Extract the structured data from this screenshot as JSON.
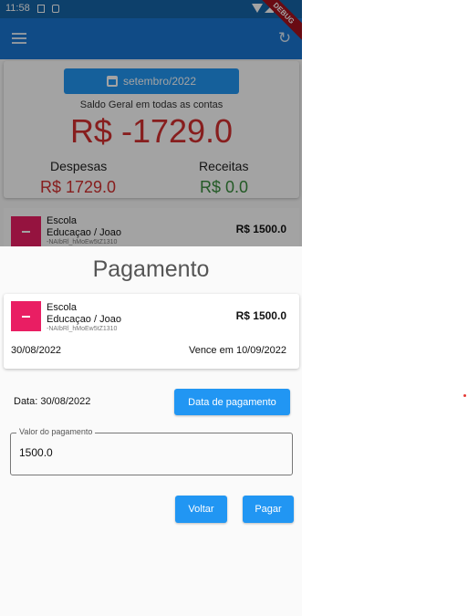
{
  "status_bar": {
    "time": "11:58"
  },
  "app_bar": {
    "debug_banner": "DEBUG"
  },
  "summary": {
    "month_button": "setembro/2022",
    "saldo_label": "Saldo Geral em todas as contas",
    "saldo_value": "R$ -1729.0",
    "despesas_label": "Despesas",
    "despesas_value": "R$ 1729.0",
    "receitas_label": "Receitas",
    "receitas_value": "R$ 0.0"
  },
  "list_item": {
    "title": "Escola",
    "subtitle": "Educaçao / Joao",
    "id": "-NAIbRl_hMoEw5tZ1310",
    "amount": "R$ 1500.0"
  },
  "sheet": {
    "title": "Pagamento",
    "card": {
      "title": "Escola",
      "subtitle": "Educaçao / Joao",
      "id": "-NAIbRl_hMoEw5tZ1310",
      "amount": "R$ 1500.0",
      "date": "30/08/2022",
      "due": "Vence em 10/09/2022"
    },
    "data_label": "Data:  30/08/2022",
    "data_button": "Data de pagamento",
    "valor_label": "Valor do pagamento",
    "valor_value": "1500.0",
    "voltar_button": "Voltar",
    "pagar_button": "Pagar"
  },
  "colors": {
    "primary": "#1976d2",
    "button": "#2196f3",
    "negative": "#d32f2f",
    "positive": "#388e3c",
    "category": "#e91e63"
  }
}
